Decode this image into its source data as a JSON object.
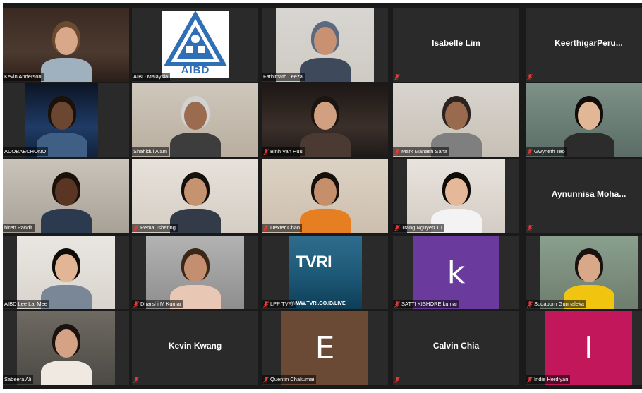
{
  "meeting": {
    "view": "gallery",
    "active_speaker": "Kevin Anderson"
  },
  "tiles": [
    {
      "id": "t01",
      "name": "Kevin Anderson",
      "label": "Kevin Anderson",
      "muted": false,
      "type": "video"
    },
    {
      "id": "t02",
      "name": "AIBD Malaysia",
      "label": "AIBD Malaysia",
      "muted": false,
      "type": "logo",
      "logo_text": "AIBD"
    },
    {
      "id": "t03",
      "name": "Fathimath Leeza",
      "label": "Fathimath Leeza",
      "muted": false,
      "type": "video"
    },
    {
      "id": "t04",
      "name": "Isabelle Lim",
      "display": "Isabelle Lim",
      "muted": true,
      "type": "name"
    },
    {
      "id": "t05",
      "name": "KeerthigarPeru...",
      "display": "KeerthigarPeru...",
      "muted": true,
      "type": "name"
    },
    {
      "id": "t06",
      "name": "ADOBAECHONO",
      "label": "ADOBAECHONO",
      "muted": false,
      "type": "video"
    },
    {
      "id": "t07",
      "name": "Shahidul Alam",
      "label": "Shahidul Alam",
      "muted": false,
      "type": "video"
    },
    {
      "id": "t08",
      "name": "Binh Van Huu",
      "label": "Binh Van Huu",
      "muted": true,
      "type": "video"
    },
    {
      "id": "t09",
      "name": "Mark Manash Saha",
      "label": "Mark Manash Saha",
      "muted": true,
      "type": "video"
    },
    {
      "id": "t10",
      "name": "Gwyneth Teo",
      "label": "Gwyneth Teo",
      "muted": true,
      "type": "video"
    },
    {
      "id": "t11",
      "name": "Hiren Pandit",
      "label": "hiren Pandit",
      "muted": false,
      "type": "video"
    },
    {
      "id": "t12",
      "name": "Pema Tshering",
      "label": "Pema Tshering",
      "muted": true,
      "type": "video"
    },
    {
      "id": "t13",
      "name": "Dexter Chan",
      "label": "Dexter Chan",
      "muted": true,
      "type": "video"
    },
    {
      "id": "t14",
      "name": "Trang Nguyen Tu",
      "label": "Trang Nguyen Tu",
      "muted": true,
      "type": "video"
    },
    {
      "id": "t15",
      "name": "Aynunnisa Moha...",
      "display": "Aynunnisa  Moha...",
      "muted": true,
      "type": "name"
    },
    {
      "id": "t16",
      "name": "AIBD Lee Lai Mee",
      "label": "AIBD Lee Lai Mee",
      "muted": false,
      "type": "video"
    },
    {
      "id": "t17",
      "name": "Dharshi M Kumar",
      "label": "Dharshi M Kumar",
      "muted": true,
      "type": "video"
    },
    {
      "id": "t18",
      "name": "LPP TVRI",
      "label": "LPP TVRI",
      "muted": true,
      "type": "logo",
      "logo_text": "TVRI",
      "logo_url": "WWW.TVRI.GO.ID/LIVE"
    },
    {
      "id": "t19",
      "name": "SATTI KISHORE kumar",
      "label": "SATTI KISHORE kumar",
      "muted": true,
      "type": "letter",
      "letter": "k",
      "color": "#6a3b9c"
    },
    {
      "id": "t20",
      "name": "Sudaporn Gunnaleka",
      "label": "Sudaporn Gunnaleka",
      "muted": true,
      "type": "video"
    },
    {
      "id": "t21",
      "name": "Sabeera Ali",
      "label": "Sabeera Ali",
      "muted": false,
      "type": "video"
    },
    {
      "id": "t22",
      "name": "Kevin Kwang",
      "display": "Kevin Kwang",
      "muted": true,
      "type": "name"
    },
    {
      "id": "t23",
      "name": "Quentin Chakumai",
      "label": "Quentin Chakumai",
      "muted": true,
      "type": "letter",
      "letter": "E",
      "color": "#6b4a35"
    },
    {
      "id": "t24",
      "name": "Calvin Chia",
      "display": "Calvin Chia",
      "muted": true,
      "type": "name"
    },
    {
      "id": "t25",
      "name": "Indie Herdiyan",
      "label": "Indie Herdiyan",
      "muted": true,
      "type": "letter",
      "letter": "I",
      "color": "#c2185b"
    }
  ],
  "colors": {
    "background": "#1a1a1a",
    "tile": "#2a2a2a",
    "active_border": "#d7e83a",
    "mute": "#e53935"
  },
  "icons": {
    "mute": "microphone-muted-icon"
  }
}
